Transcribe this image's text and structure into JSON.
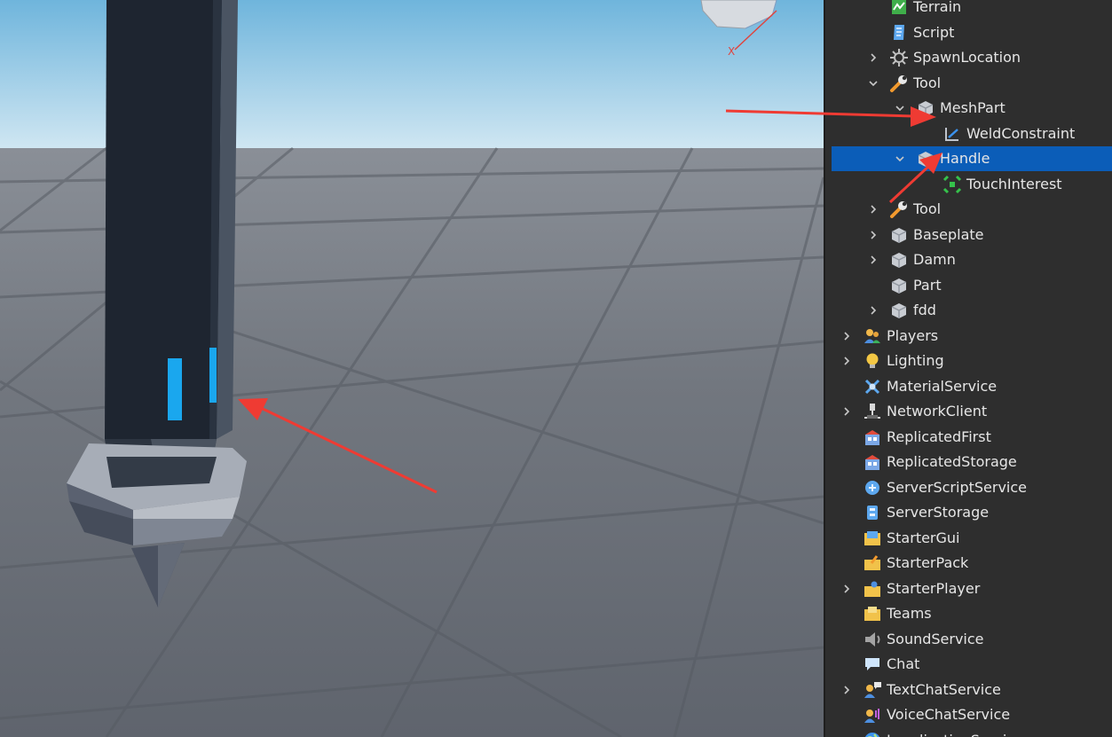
{
  "viewport": {
    "axis_label": "X",
    "colors": {
      "sky_top": "#6fb5dc",
      "sky_bottom": "#cfe6f2",
      "ground": "#6e737c",
      "handle_dark": "#1e2530",
      "accent_blue": "#1aa7ee",
      "guard_light": "#a7adb7",
      "arrow_red": "#ef3b33"
    }
  },
  "explorer": {
    "items": [
      {
        "label": "Terrain",
        "icon": "terrain-icon",
        "chevron": "none"
      },
      {
        "label": "Script",
        "icon": "script-icon",
        "chevron": "none"
      },
      {
        "label": "SpawnLocation",
        "icon": "spawn-location-icon",
        "chevron": "collapsed"
      },
      {
        "label": "Tool",
        "icon": "tool-icon",
        "chevron": "expanded"
      },
      {
        "label": "MeshPart",
        "icon": "part-icon",
        "chevron": "expanded"
      },
      {
        "label": "WeldConstraint",
        "icon": "weld-constraint-icon",
        "chevron": "none"
      },
      {
        "label": "Handle",
        "icon": "part-icon",
        "chevron": "expanded",
        "selected": true
      },
      {
        "label": "TouchInterest",
        "icon": "touch-interest-icon",
        "chevron": "none"
      },
      {
        "label": "Tool",
        "icon": "tool-icon",
        "chevron": "collapsed"
      },
      {
        "label": "Baseplate",
        "icon": "part-icon",
        "chevron": "collapsed"
      },
      {
        "label": "Damn",
        "icon": "part-icon",
        "chevron": "collapsed"
      },
      {
        "label": "Part",
        "icon": "part-icon",
        "chevron": "none"
      },
      {
        "label": "fdd",
        "icon": "part-icon",
        "chevron": "collapsed"
      },
      {
        "label": "Players",
        "icon": "players-icon",
        "chevron": "collapsed"
      },
      {
        "label": "Lighting",
        "icon": "lighting-icon",
        "chevron": "collapsed"
      },
      {
        "label": "MaterialService",
        "icon": "material-service-icon",
        "chevron": "none"
      },
      {
        "label": "NetworkClient",
        "icon": "network-client-icon",
        "chevron": "collapsed"
      },
      {
        "label": "ReplicatedFirst",
        "icon": "replicated-first-icon",
        "chevron": "none"
      },
      {
        "label": "ReplicatedStorage",
        "icon": "replicated-storage-icon",
        "chevron": "none"
      },
      {
        "label": "ServerScriptService",
        "icon": "server-script-service-icon",
        "chevron": "none"
      },
      {
        "label": "ServerStorage",
        "icon": "server-storage-icon",
        "chevron": "none"
      },
      {
        "label": "StarterGui",
        "icon": "starter-gui-icon",
        "chevron": "none"
      },
      {
        "label": "StarterPack",
        "icon": "starter-pack-icon",
        "chevron": "none"
      },
      {
        "label": "StarterPlayer",
        "icon": "starter-player-icon",
        "chevron": "collapsed"
      },
      {
        "label": "Teams",
        "icon": "teams-icon",
        "chevron": "none"
      },
      {
        "label": "SoundService",
        "icon": "sound-service-icon",
        "chevron": "none"
      },
      {
        "label": "Chat",
        "icon": "chat-icon",
        "chevron": "none"
      },
      {
        "label": "TextChatService",
        "icon": "text-chat-service-icon",
        "chevron": "collapsed"
      },
      {
        "label": "VoiceChatService",
        "icon": "voice-chat-service-icon",
        "chevron": "none"
      },
      {
        "label": "LocalizationService",
        "icon": "localization-service-icon",
        "chevron": "none"
      }
    ],
    "colors": {
      "background": "#2e2e2e",
      "selected": "#0b5db8",
      "text": "#e6e6e6"
    }
  }
}
